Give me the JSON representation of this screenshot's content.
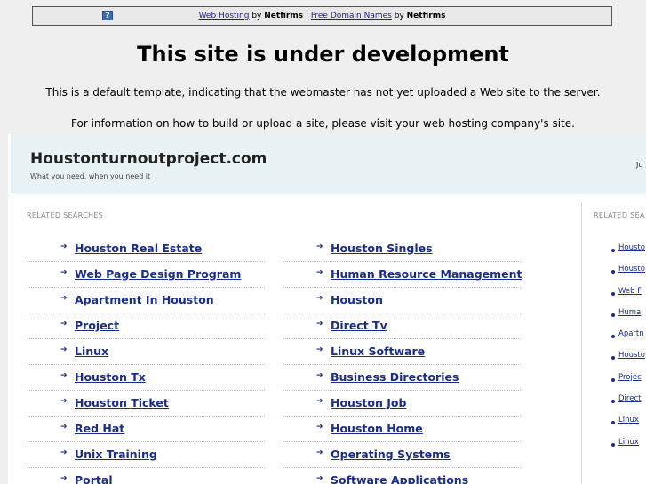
{
  "topbar": {
    "link1": "Web Hosting",
    "by1": "by",
    "brand1": "Netfirms",
    "sep": "|",
    "link2": "Free Domain Names",
    "by2": "by",
    "brand2": "Netfirms",
    "icon": "?"
  },
  "heading": "This site is under development",
  "notes": [
    "This is a default template, indicating that the webmaster has not yet uploaded a Web site to the server.",
    "For information on how to build or upload a site, please visit your web hosting company's site."
  ],
  "parked": {
    "domain": "Houstonturnoutproject.com",
    "tagline": "What you need, when you need it",
    "truncated_right": "Ju",
    "related_label": "RELATED SEARCHES",
    "related_label_right": "RELATED SEA",
    "left_column": [
      "Houston Real Estate",
      "Web Page Design Program",
      "Apartment In Houston",
      "Project",
      "Linux",
      "Houston Tx",
      "Houston Ticket",
      "Red Hat",
      "Unix Training",
      "Portal"
    ],
    "right_column": [
      "Houston Singles",
      "Human Resource Management",
      "Houston",
      "Direct Tv",
      "Linux Software",
      "Business Directories",
      "Houston Job",
      "Houston Home",
      "Operating Systems",
      "Software Applications"
    ],
    "side_column": [
      "Housto",
      "Housto",
      "Web F",
      "Huma",
      "Apartn",
      "Housto",
      "Projec",
      "Direct",
      "Linux",
      "Linux"
    ]
  }
}
